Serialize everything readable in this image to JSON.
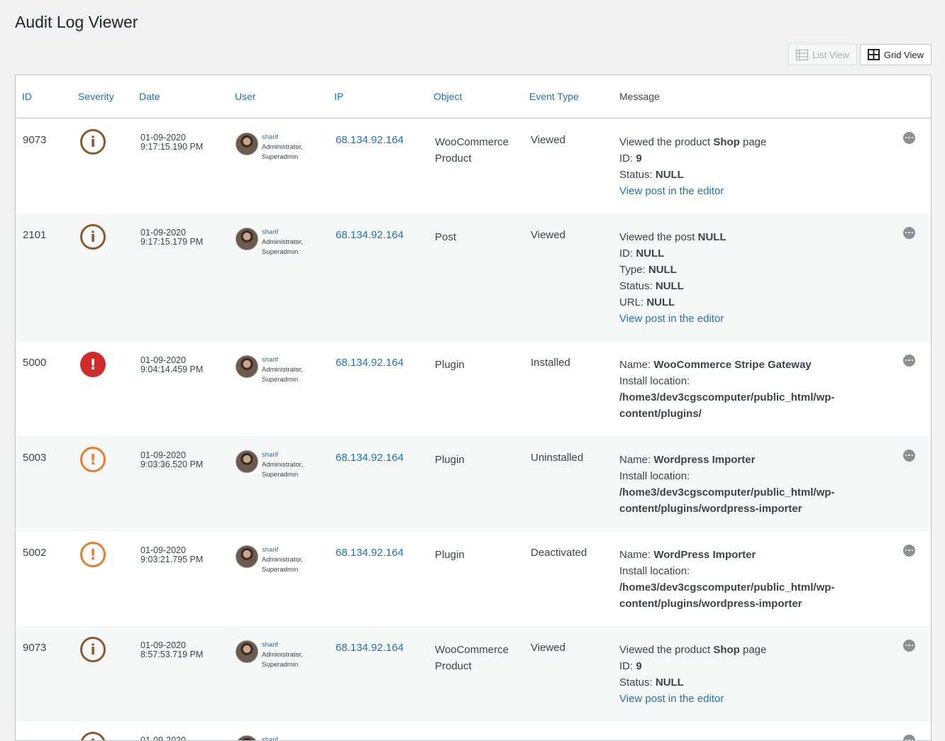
{
  "page": {
    "title": "Audit Log Viewer"
  },
  "view_switch": {
    "list_label": "List View",
    "grid_label": "Grid View"
  },
  "columns": [
    "ID",
    "Severity",
    "Date",
    "User",
    "IP",
    "Object",
    "Event Type",
    "Message"
  ],
  "rows": [
    {
      "id": "9073",
      "severity": "info",
      "date": "01-09-2020",
      "time": "9:17:15.190 PM",
      "user": "sharif",
      "roles1": "Administrator,",
      "roles2": "Superadmin",
      "ip": "68.134.92.164",
      "object": "WooCommerce Product",
      "event": "Viewed",
      "msg": [
        {
          "pre": "Viewed the product ",
          "bold": "Shop",
          "post": " page"
        },
        {
          "pre": "ID: ",
          "bold": "9",
          "post": ""
        },
        {
          "pre": "Status: ",
          "bold": "NULL",
          "post": ""
        },
        {
          "link": "View post in the editor"
        }
      ]
    },
    {
      "id": "2101",
      "severity": "info",
      "date": "01-09-2020",
      "time": "9:17:15.179 PM",
      "user": "sharif",
      "roles1": "Administrator,",
      "roles2": "Superadmin",
      "ip": "68.134.92.164",
      "object": "Post",
      "event": "Viewed",
      "msg": [
        {
          "pre": "Viewed the post ",
          "bold": "NULL",
          "post": ""
        },
        {
          "pre": "ID: ",
          "bold": "NULL",
          "post": ""
        },
        {
          "pre": "Type: ",
          "bold": "NULL",
          "post": ""
        },
        {
          "pre": "Status: ",
          "bold": "NULL",
          "post": ""
        },
        {
          "pre": "URL: ",
          "bold": "NULL",
          "post": ""
        },
        {
          "link": "View post in the editor"
        }
      ]
    },
    {
      "id": "5000",
      "severity": "critical",
      "date": "01-09-2020",
      "time": "9:04:14.459 PM",
      "user": "sharif",
      "roles1": "Administrator,",
      "roles2": "Superadmin",
      "ip": "68.134.92.164",
      "object": "Plugin",
      "event": "Installed",
      "msg": [
        {
          "pre": "Name: ",
          "bold": "WooCommerce Stripe Gateway",
          "post": ""
        },
        {
          "pre": "Install location:",
          "bold": "",
          "post": ""
        },
        {
          "pre": "",
          "bold": "/home3/dev3cgscomputer/public_html/wp-content/plugins/",
          "post": ""
        }
      ]
    },
    {
      "id": "5003",
      "severity": "high",
      "date": "01-09-2020",
      "time": "9:03:36.520 PM",
      "user": "sharif",
      "roles1": "Administrator,",
      "roles2": "Superadmin",
      "ip": "68.134.92.164",
      "object": "Plugin",
      "event": "Uninstalled",
      "msg": [
        {
          "pre": "Name: ",
          "bold": "Wordpress Importer",
          "post": ""
        },
        {
          "pre": "Install location:",
          "bold": "",
          "post": ""
        },
        {
          "pre": "",
          "bold": "/home3/dev3cgscomputer/public_html/wp-content/plugins/wordpress-importer",
          "post": ""
        }
      ]
    },
    {
      "id": "5002",
      "severity": "high",
      "date": "01-09-2020",
      "time": "9:03:21.795 PM",
      "user": "sharif",
      "roles1": "Administrator,",
      "roles2": "Superadmin",
      "ip": "68.134.92.164",
      "object": "Plugin",
      "event": "Deactivated",
      "msg": [
        {
          "pre": "Name: ",
          "bold": "WordPress Importer",
          "post": ""
        },
        {
          "pre": "Install location:",
          "bold": "",
          "post": ""
        },
        {
          "pre": "",
          "bold": "/home3/dev3cgscomputer/public_html/wp-content/plugins/wordpress-importer",
          "post": ""
        }
      ]
    },
    {
      "id": "9073",
      "severity": "info",
      "date": "01-09-2020",
      "time": "8:57:53.719 PM",
      "user": "sharif",
      "roles1": "Administrator,",
      "roles2": "Superadmin",
      "ip": "68.134.92.164",
      "object": "WooCommerce Product",
      "event": "Viewed",
      "msg": [
        {
          "pre": "Viewed the product ",
          "bold": "Shop",
          "post": " page"
        },
        {
          "pre": "ID: ",
          "bold": "9",
          "post": ""
        },
        {
          "pre": "Status: ",
          "bold": "NULL",
          "post": ""
        },
        {
          "link": "View post in the editor"
        }
      ]
    },
    {
      "id": "",
      "severity": "info",
      "date": "01-09-2020",
      "time": "",
      "user": "sharif",
      "roles1": "",
      "roles2": "",
      "ip": "",
      "object": "",
      "event": "",
      "msg": []
    }
  ],
  "severity_glyphs": {
    "info": "i",
    "high": "!",
    "critical": "!"
  },
  "colors": {
    "link": "#2271b1",
    "info": "#8a5a2e",
    "high": "#ea7b2c",
    "critical": "#d12c2c"
  }
}
